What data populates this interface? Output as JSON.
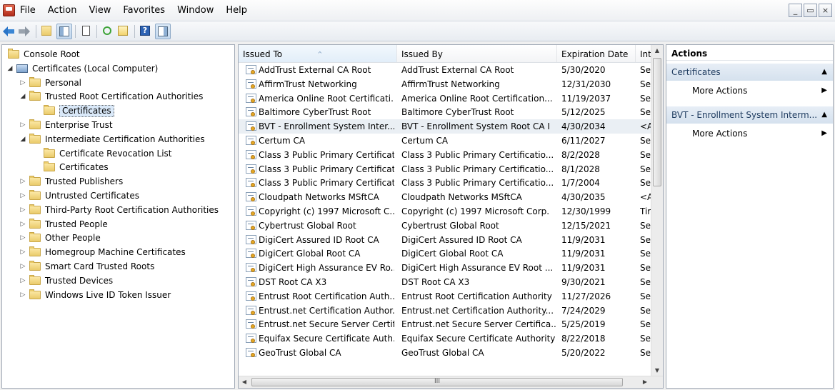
{
  "menu": [
    "File",
    "Action",
    "View",
    "Favorites",
    "Window",
    "Help"
  ],
  "window_buttons": [
    "_",
    "▭",
    "×"
  ],
  "tree": [
    {
      "label": "Console Root",
      "level": 0,
      "toggle": "",
      "icon": "folder"
    },
    {
      "label": "Certificates (Local Computer)",
      "level": 1,
      "toggle": "open",
      "icon": "computer"
    },
    {
      "label": "Personal",
      "level": 2,
      "toggle": "closed",
      "icon": "folder"
    },
    {
      "label": "Trusted Root Certification Authorities",
      "level": 2,
      "toggle": "open",
      "icon": "folder"
    },
    {
      "label": "Certificates",
      "level": 3,
      "toggle": "",
      "icon": "folder",
      "selected": true
    },
    {
      "label": "Enterprise Trust",
      "level": 2,
      "toggle": "closed",
      "icon": "folder"
    },
    {
      "label": "Intermediate Certification Authorities",
      "level": 2,
      "toggle": "open",
      "icon": "folder"
    },
    {
      "label": "Certificate Revocation List",
      "level": 3,
      "toggle": "",
      "icon": "folder"
    },
    {
      "label": "Certificates",
      "level": 3,
      "toggle": "",
      "icon": "folder"
    },
    {
      "label": "Trusted Publishers",
      "level": 2,
      "toggle": "closed",
      "icon": "folder"
    },
    {
      "label": "Untrusted Certificates",
      "level": 2,
      "toggle": "closed",
      "icon": "folder"
    },
    {
      "label": "Third-Party Root Certification Authorities",
      "level": 2,
      "toggle": "closed",
      "icon": "folder"
    },
    {
      "label": "Trusted People",
      "level": 2,
      "toggle": "closed",
      "icon": "folder"
    },
    {
      "label": "Other People",
      "level": 2,
      "toggle": "closed",
      "icon": "folder"
    },
    {
      "label": "Homegroup Machine Certificates",
      "level": 2,
      "toggle": "closed",
      "icon": "folder"
    },
    {
      "label": "Smart Card Trusted Roots",
      "level": 2,
      "toggle": "closed",
      "icon": "folder"
    },
    {
      "label": "Trusted Devices",
      "level": 2,
      "toggle": "closed",
      "icon": "folder"
    },
    {
      "label": "Windows Live ID Token Issuer",
      "level": 2,
      "toggle": "closed",
      "icon": "folder"
    }
  ],
  "list": {
    "columns": [
      "Issued To",
      "Issued By",
      "Expiration Date",
      "Int"
    ],
    "rows": [
      [
        "AddTrust External CA Root",
        "AddTrust External CA Root",
        "5/30/2020",
        "Se"
      ],
      [
        "AffirmTrust Networking",
        "AffirmTrust Networking",
        "12/31/2030",
        "Se"
      ],
      [
        "America Online Root Certificati...",
        "America Online Root Certification...",
        "11/19/2037",
        "Se"
      ],
      [
        "Baltimore CyberTrust Root",
        "Baltimore CyberTrust Root",
        "5/12/2025",
        "Se"
      ],
      [
        "BVT - Enrollment System Inter...",
        "BVT - Enrollment System Root CA I",
        "4/30/2034",
        "<A"
      ],
      [
        "Certum CA",
        "Certum CA",
        "6/11/2027",
        "Se"
      ],
      [
        "Class 3 Public Primary Certificat...",
        "Class 3 Public Primary Certificatio...",
        "8/2/2028",
        "Se"
      ],
      [
        "Class 3 Public Primary Certificat...",
        "Class 3 Public Primary Certificatio...",
        "8/1/2028",
        "Se"
      ],
      [
        "Class 3 Public Primary Certificat...",
        "Class 3 Public Primary Certificatio...",
        "1/7/2004",
        "Se"
      ],
      [
        "Cloudpath Networks MSftCA",
        "Cloudpath Networks MSftCA",
        "4/30/2035",
        "<A"
      ],
      [
        "Copyright (c) 1997 Microsoft C...",
        "Copyright (c) 1997 Microsoft Corp.",
        "12/30/1999",
        "Tir"
      ],
      [
        "Cybertrust Global Root",
        "Cybertrust Global Root",
        "12/15/2021",
        "Se"
      ],
      [
        "DigiCert Assured ID Root CA",
        "DigiCert Assured ID Root CA",
        "11/9/2031",
        "Se"
      ],
      [
        "DigiCert Global Root CA",
        "DigiCert Global Root CA",
        "11/9/2031",
        "Se"
      ],
      [
        "DigiCert High Assurance EV Ro...",
        "DigiCert High Assurance EV Root ...",
        "11/9/2031",
        "Se"
      ],
      [
        "DST Root CA X3",
        "DST Root CA X3",
        "9/30/2021",
        "Se"
      ],
      [
        "Entrust Root Certification Auth...",
        "Entrust Root Certification Authority",
        "11/27/2026",
        "Se"
      ],
      [
        "Entrust.net Certification Author...",
        "Entrust.net Certification Authority...",
        "7/24/2029",
        "Se"
      ],
      [
        "Entrust.net Secure Server Certifi...",
        "Entrust.net Secure Server Certifica...",
        "5/25/2019",
        "Se"
      ],
      [
        "Equifax Secure Certificate Auth...",
        "Equifax Secure Certificate Authority",
        "8/22/2018",
        "Se"
      ],
      [
        "GeoTrust Global CA",
        "GeoTrust Global CA",
        "5/20/2022",
        "Se"
      ]
    ],
    "selected_row": 4,
    "hscroll_grip": "III"
  },
  "actions": {
    "title": "Actions",
    "sections": [
      {
        "label": "Certificates",
        "items": [
          "More Actions"
        ]
      },
      {
        "label": "BVT - Enrollment System Interm...",
        "items": [
          "More Actions"
        ]
      }
    ]
  }
}
